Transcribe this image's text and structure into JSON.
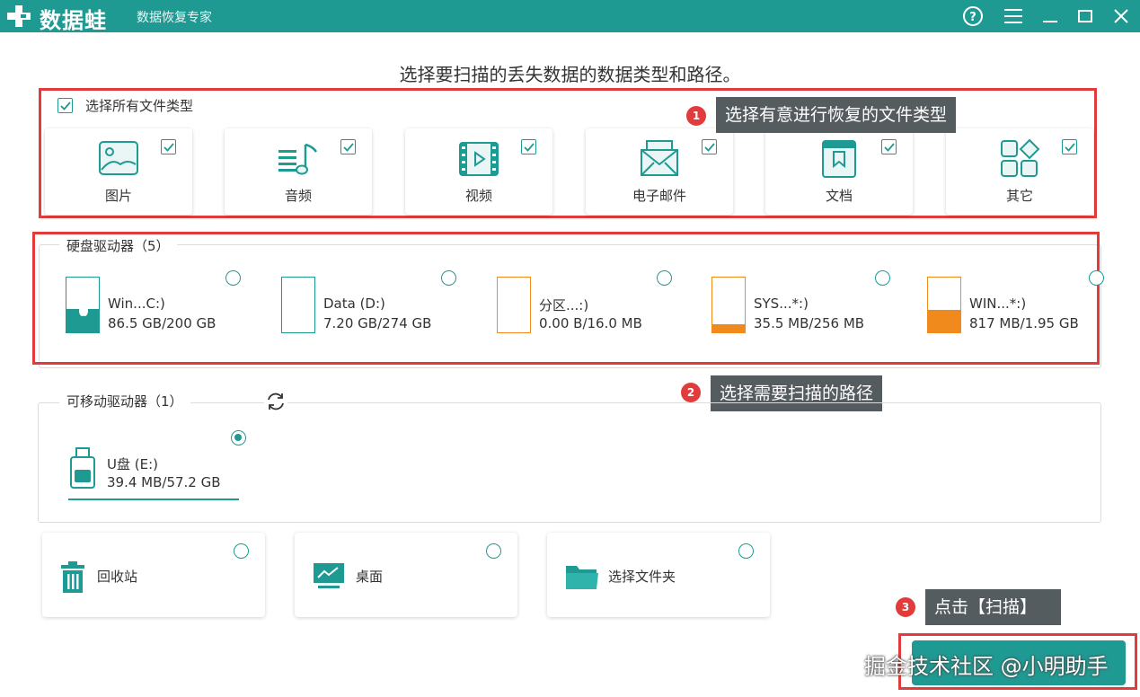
{
  "app": {
    "logo": "数据蛙",
    "subtitle": "数据恢复专家"
  },
  "titlebar": {
    "icons": [
      "help-icon",
      "menu-icon",
      "minimize-icon",
      "maximize-icon",
      "close-icon"
    ]
  },
  "headline": "选择要扫描的丢失数据的数据类型和路径。",
  "file_types": {
    "select_all": "选择所有文件类型",
    "items": [
      {
        "label": "图片",
        "icon": "image-icon",
        "checked": true
      },
      {
        "label": "音频",
        "icon": "audio-icon",
        "checked": true
      },
      {
        "label": "视频",
        "icon": "video-icon",
        "checked": true
      },
      {
        "label": "电子邮件",
        "icon": "email-icon",
        "checked": true
      },
      {
        "label": "文档",
        "icon": "document-icon",
        "checked": true
      },
      {
        "label": "其它",
        "icon": "other-icon",
        "checked": true
      }
    ]
  },
  "callouts": [
    {
      "num": "1",
      "text": "选择有意进行恢复的文件类型"
    },
    {
      "num": "2",
      "text": "选择需要扫描的路径"
    },
    {
      "num": "3",
      "text": "点击【扫描】"
    }
  ],
  "hard_drives": {
    "title": "硬盘驱动器（5）",
    "items": [
      {
        "name": "Win...C:)",
        "size": "86.5 GB/200 GB",
        "used_fraction": 0.43,
        "color": "#1f9a93",
        "selected": false
      },
      {
        "name": "Data (D:)",
        "size": "7.20 GB/274 GB",
        "used_fraction": 0.0,
        "color": "#1f9a93",
        "selected": false
      },
      {
        "name": "分区...:)",
        "size": "0.00  B/16.0 MB",
        "used_fraction": 0.0,
        "color": "#f08a1c",
        "selected": false
      },
      {
        "name": "SYS...*:)",
        "size": "35.5 MB/256 MB",
        "used_fraction": 0.14,
        "color": "#f08a1c",
        "selected": false
      },
      {
        "name": "WIN...*:)",
        "size": "817 MB/1.95 GB",
        "used_fraction": 0.41,
        "color": "#f08a1c",
        "selected": false
      }
    ]
  },
  "removable": {
    "title": "可移动驱动器（1）",
    "items": [
      {
        "name": "U盘 (E:)",
        "size": "39.4 MB/57.2 GB",
        "selected": true
      }
    ]
  },
  "locations": [
    {
      "label": "回收站",
      "icon": "recycle-bin-icon"
    },
    {
      "label": "桌面",
      "icon": "desktop-icon"
    },
    {
      "label": "选择文件夹",
      "icon": "folder-icon"
    }
  ],
  "scan_button": {
    "label": ""
  },
  "watermark": "掘金技术社区 @小明助手"
}
